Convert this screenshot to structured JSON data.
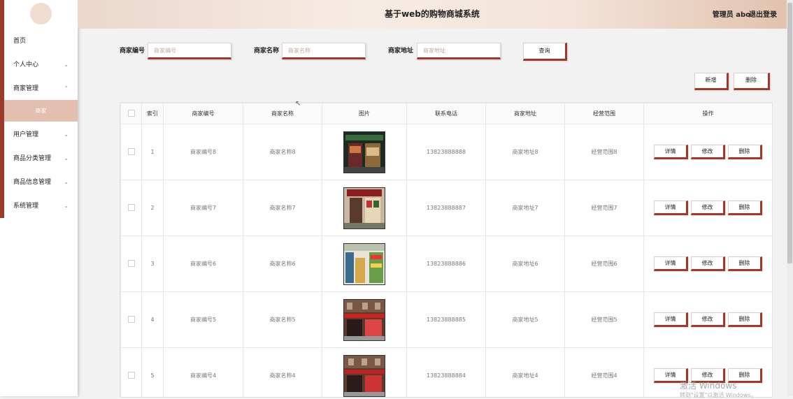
{
  "header": {
    "title": "基于web的购物商城系统",
    "user": "管理员 abo",
    "logout": "退出登录"
  },
  "sidebar": {
    "items": [
      {
        "label": "首页",
        "chevron": ""
      },
      {
        "label": "个人中心",
        "chevron": "⌄"
      },
      {
        "label": "商家管理",
        "chevron": "⌃"
      },
      {
        "label": "用户管理",
        "chevron": "⌄"
      },
      {
        "label": "商品分类管理",
        "chevron": "⌄"
      },
      {
        "label": "商品信息管理",
        "chevron": "⌄"
      },
      {
        "label": "系统管理",
        "chevron": "⌄"
      }
    ],
    "sub_item": "商家"
  },
  "search": {
    "fields": [
      {
        "label": "商家编号",
        "placeholder": "商家编号"
      },
      {
        "label": "商家名称",
        "placeholder": "商家名称"
      },
      {
        "label": "商家地址",
        "placeholder": "商家地址"
      }
    ],
    "query_button": "查询"
  },
  "actions": {
    "add": "新增",
    "delete": "删除"
  },
  "table": {
    "columns": [
      "索引",
      "商家编号",
      "商家名称",
      "图片",
      "联系电话",
      "商家地址",
      "经营范围",
      "操作"
    ],
    "rows": [
      {
        "index": "1",
        "code": "商家编号8",
        "name": "商家名称8",
        "phone": "13823888888",
        "address": "商家地址8",
        "scope": "经营范围8"
      },
      {
        "index": "2",
        "code": "商家编号7",
        "name": "商家名称7",
        "phone": "13823888887",
        "address": "商家地址7",
        "scope": "经营范围7"
      },
      {
        "index": "3",
        "code": "商家编号6",
        "name": "商家名称6",
        "phone": "13823888886",
        "address": "商家地址6",
        "scope": "经营范围6"
      },
      {
        "index": "4",
        "code": "商家编号5",
        "name": "商家名称5",
        "phone": "13823888885",
        "address": "商家地址5",
        "scope": "经营范围5"
      },
      {
        "index": "5",
        "code": "商家编号4",
        "name": "商家名称4",
        "phone": "13823888884",
        "address": "商家地址4",
        "scope": "经营范围4"
      }
    ],
    "row_actions": {
      "detail": "详情",
      "edit": "修改",
      "delete": "删除"
    }
  },
  "watermark": {
    "line1": "激活 Windows",
    "line2": "转到\"设置\"以激活 Windows。"
  },
  "colors": {
    "accent": "#9a3b2c",
    "header_gradient_start": "#ebd7cc",
    "sub_active": "#e2bfae"
  }
}
